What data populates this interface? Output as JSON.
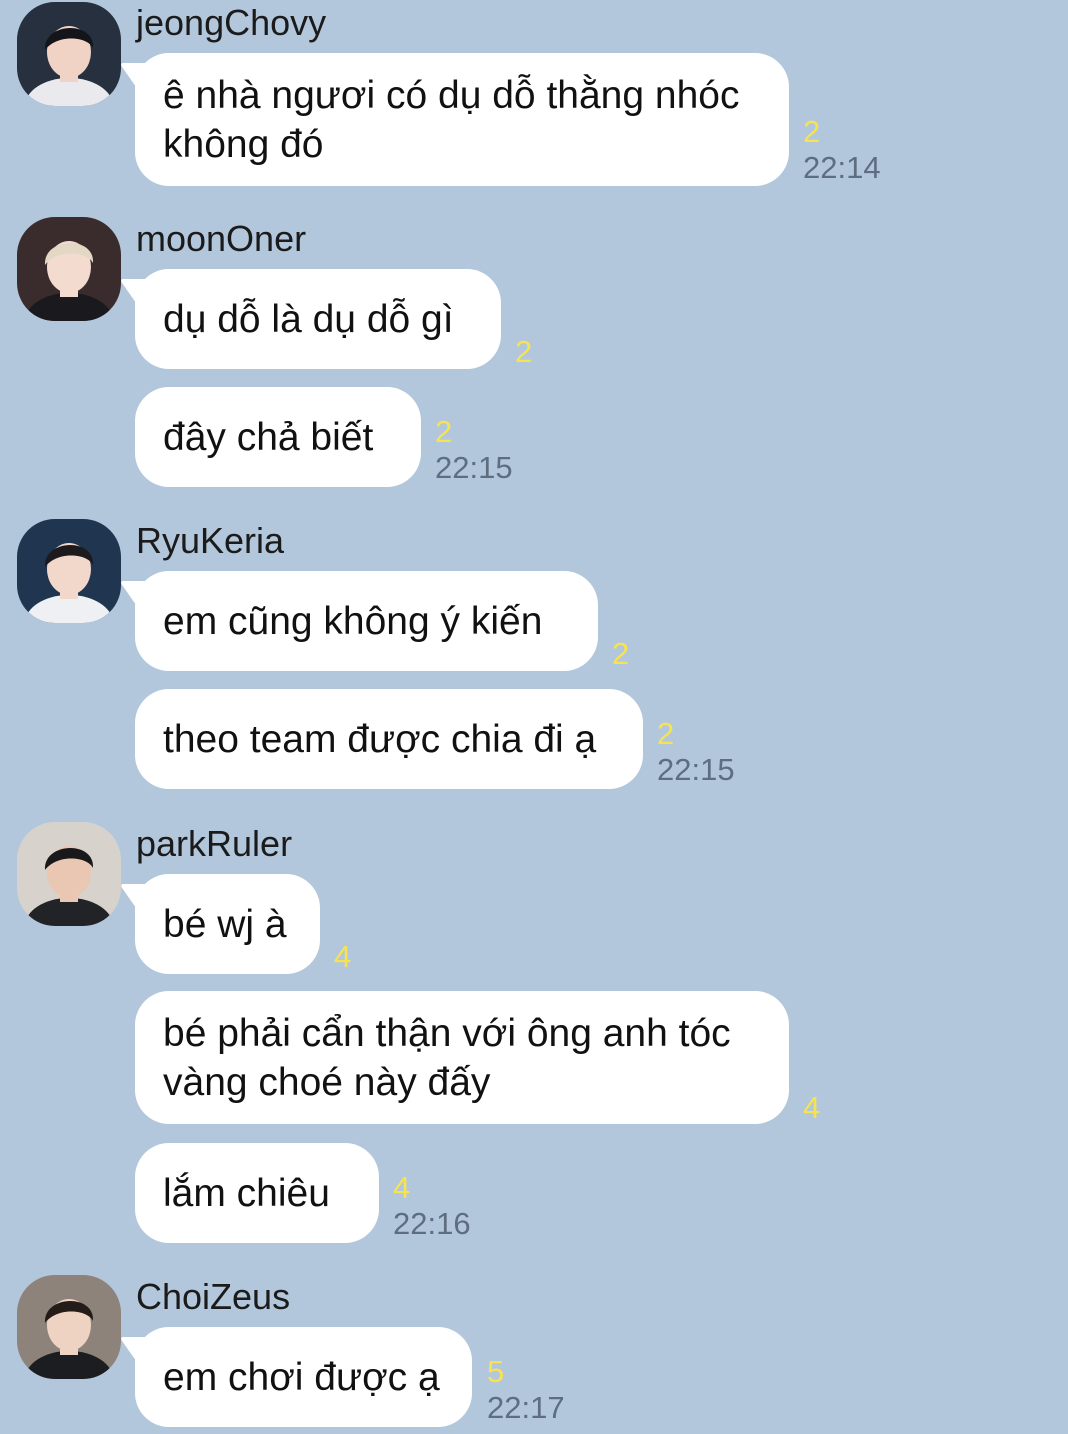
{
  "colors": {
    "background": "#b3c7dc",
    "bubble": "#ffffff",
    "unread_count": "#f7e34f",
    "timestamp": "#5e6e80"
  },
  "groups": [
    {
      "sender": "jeongChovy",
      "avatar": "profile-photo",
      "messages": [
        {
          "text": "ê nhà ngươi có dụ dỗ thằng nhóc\nkhông đó",
          "unread": "2",
          "time": "22:14"
        }
      ]
    },
    {
      "sender": "moonOner",
      "avatar": "profile-photo",
      "messages": [
        {
          "text": "dụ dỗ là dụ dỗ gì",
          "unread": "2",
          "time": ""
        },
        {
          "text": "đây chả biết",
          "unread": "2",
          "time": "22:15"
        }
      ]
    },
    {
      "sender": "RyuKeria",
      "avatar": "profile-photo",
      "messages": [
        {
          "text": "em cũng không ý kiến",
          "unread": "2",
          "time": ""
        },
        {
          "text": "theo team được chia đi ạ",
          "unread": "2",
          "time": "22:15"
        }
      ]
    },
    {
      "sender": "parkRuler",
      "avatar": "profile-photo",
      "messages": [
        {
          "text": "bé wj à",
          "unread": "4",
          "time": ""
        },
        {
          "text": "bé phải cẩn thận với ông anh tóc\nvàng choé này đấy",
          "unread": "4",
          "time": ""
        },
        {
          "text": "lắm chiêu",
          "unread": "4",
          "time": "22:16"
        }
      ]
    },
    {
      "sender": "ChoiZeus",
      "avatar": "profile-photo",
      "messages": [
        {
          "text": "em chơi được ạ",
          "unread": "5",
          "time": "22:17"
        }
      ]
    }
  ]
}
